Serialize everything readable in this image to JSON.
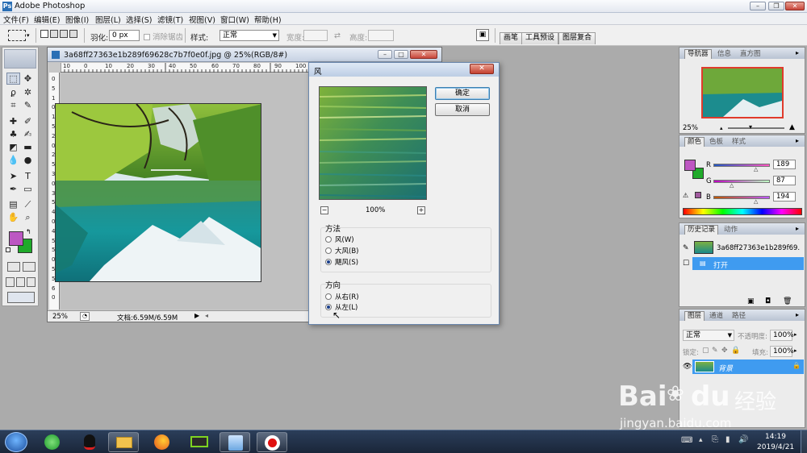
{
  "window": {
    "app_title": "Adobe Photoshop",
    "min": "–",
    "max": "❐",
    "close": "✕"
  },
  "menu": [
    "文件(F)",
    "编辑(E)",
    "图像(I)",
    "图层(L)",
    "选择(S)",
    "滤镜(T)",
    "视图(V)",
    "窗口(W)",
    "帮助(H)"
  ],
  "options": {
    "feather_label": "羽化:",
    "feather_value": "0 px",
    "antialias_label": "消除锯齿",
    "style_label": "样式:",
    "style_value": "正常",
    "width_label": "宽度:",
    "height_label": "高度:",
    "tabs": [
      "画笔",
      "工具预设",
      "图层复合"
    ]
  },
  "document": {
    "title": "3a68ff27363e1b289f69628c7b7f0e0f.jpg @ 25%(RGB/8#)",
    "ruler_top": [
      "10",
      "0",
      "10",
      "20",
      "30",
      "40",
      "50",
      "60",
      "70",
      "80",
      "90",
      "100"
    ],
    "ruler_left": [
      "0",
      "5",
      "1",
      "0",
      "1",
      "5",
      "2",
      "0",
      "2",
      "5",
      "3",
      "0",
      "3",
      "5",
      "4",
      "0",
      "4",
      "5",
      "5",
      "0",
      "5",
      "5",
      "6",
      "0"
    ],
    "zoom": "25%",
    "status": "文档:6.59M/6.59M"
  },
  "dialog": {
    "title": "风",
    "ok": "确定",
    "cancel": "取消",
    "zoom_out": "−",
    "zoom_in": "+",
    "zoom": "100%",
    "method_label": "方法",
    "methods": [
      {
        "label": "风(W)",
        "checked": false
      },
      {
        "label": "大风(B)",
        "checked": false
      },
      {
        "label": "飓风(S)",
        "checked": true
      }
    ],
    "direction_label": "方向",
    "directions": [
      {
        "label": "从右(R)",
        "checked": false
      },
      {
        "label": "从左(L)",
        "checked": true
      }
    ]
  },
  "navigator": {
    "tabs": [
      "导航器",
      "信息",
      "直方图"
    ],
    "zoom": "25%"
  },
  "color": {
    "tabs": [
      "颜色",
      "色板",
      "样式"
    ],
    "r_label": "R",
    "r_value": "189",
    "g_label": "G",
    "g_value": "87",
    "b_label": "B",
    "b_value": "194",
    "fg": "#bd57c2",
    "bg": "#1faa2a"
  },
  "history": {
    "tabs": [
      "历史记录",
      "动作"
    ],
    "snapshot": "3a68ff27363e1b289f69...",
    "step": "打开"
  },
  "layers": {
    "tabs": [
      "图层",
      "通道",
      "路径"
    ],
    "blend_mode": "正常",
    "opacity_label": "不透明度:",
    "opacity_value": "100%",
    "lock_label": "锁定:",
    "fill_label": "填充:",
    "fill_value": "100%",
    "layer_name": "背景"
  },
  "watermark": {
    "brand": "Bai",
    "brand2": "du",
    "suffix": "经验",
    "url": "jingyan.baidu.com"
  },
  "taskbar": {
    "time": "14:19",
    "date": "2019/4/21"
  },
  "colors": {
    "selection_blue": "#3f9bf0",
    "accent_purple": "#bd57c2",
    "accent_green": "#1faa2a"
  }
}
